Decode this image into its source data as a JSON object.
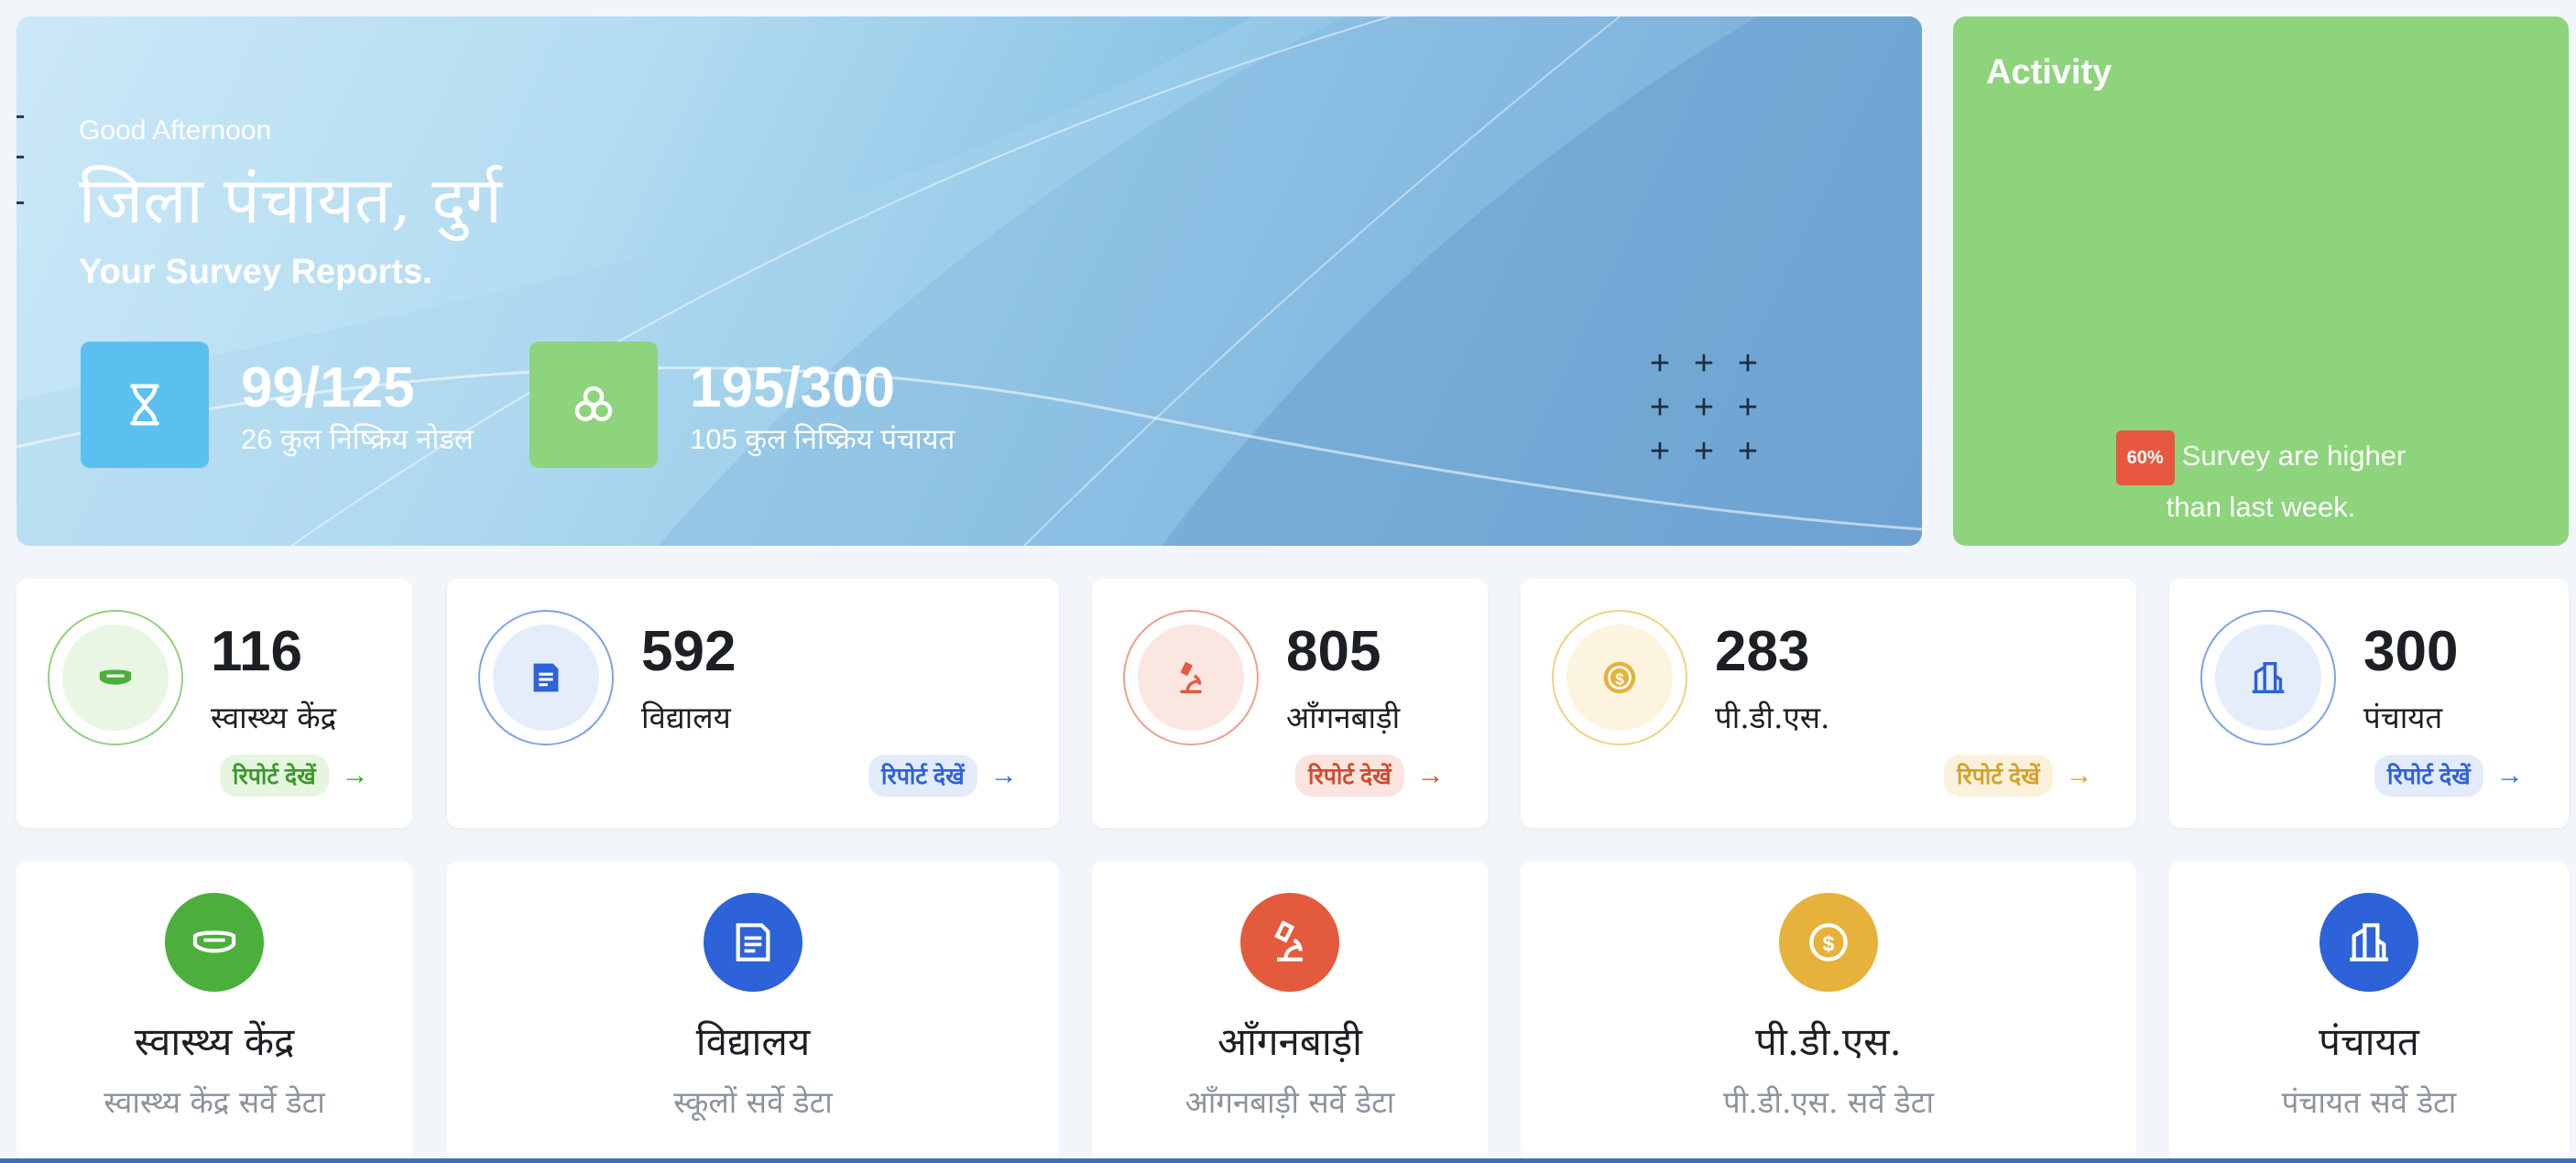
{
  "banner": {
    "greeting": "Good Afternoon",
    "title": "जिला पंचायत, दुर्ग",
    "subtitle": "Your Survey Reports.",
    "stats": [
      {
        "icon": "hourglass-icon",
        "value": "99/125",
        "label": "26 कुल निष्क्रिय नोडल",
        "color": "#5bc0f0"
      },
      {
        "icon": "circles-icon",
        "value": "195/300",
        "label": "105 कुल निष्क्रिय पंचायत",
        "color": "#8dd47c"
      }
    ]
  },
  "activity": {
    "title": "Activity",
    "badge": "60%",
    "text_line1": "Survey are higher",
    "text_line2": "than last week."
  },
  "summary_cards": [
    {
      "icon": "mask-icon",
      "count": "116",
      "label": "स्वास्थ्य केंद्र",
      "report": "रिपोर्ट देखें",
      "arrow": "→",
      "color": "#4caf3c"
    },
    {
      "icon": "book-icon",
      "count": "592",
      "label": "विद्यालय",
      "report": "रिपोर्ट देखें",
      "arrow": "→",
      "color": "#2d62d8"
    },
    {
      "icon": "microscope-icon",
      "count": "805",
      "label": "आँगनबाड़ी",
      "report": "रिपोर्ट देखें",
      "arrow": "→",
      "color": "#e45a3c"
    },
    {
      "icon": "coin-icon",
      "count": "283",
      "label": "पी.डी.एस.",
      "report": "रिपोर्ट देखें",
      "arrow": "→",
      "color": "#e6b23c"
    },
    {
      "icon": "building-icon",
      "count": "300",
      "label": "पंचायत",
      "report": "रिपोर्ट देखें",
      "arrow": "→",
      "color": "#2d62d8"
    }
  ],
  "data_cards": [
    {
      "icon": "mask-icon",
      "title": "स्वास्थ्य केंद्र",
      "subtitle": "स्वास्थ्य केंद्र सर्वे डेटा",
      "color": "#4caf3c"
    },
    {
      "icon": "book-icon",
      "title": "विद्यालय",
      "subtitle": "स्कूलों सर्वे डेटा",
      "color": "#2d62d8"
    },
    {
      "icon": "microscope-icon",
      "title": "आँगनबाड़ी",
      "subtitle": "आँगनबाड़ी सर्वे डेटा",
      "color": "#e45a3c"
    },
    {
      "icon": "coin-icon",
      "title": "पी.डी.एस.",
      "subtitle": "पी.डी.एस. सर्वे डेटा",
      "color": "#e6b23c"
    },
    {
      "icon": "building-icon",
      "title": "पंचायत",
      "subtitle": "पंचायत सर्वे डेटा",
      "color": "#2d62d8"
    }
  ]
}
